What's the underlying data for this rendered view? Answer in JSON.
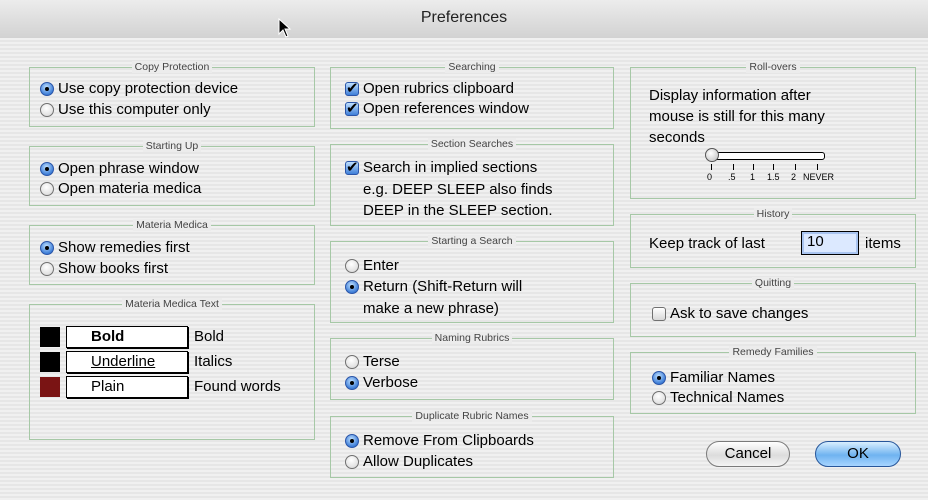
{
  "window": {
    "title": "Preferences"
  },
  "copy_protection": {
    "legend": "Copy Protection",
    "options": [
      {
        "label": "Use copy protection device",
        "selected": true
      },
      {
        "label": "Use this computer only",
        "selected": false
      }
    ]
  },
  "starting_up": {
    "legend": "Starting Up",
    "options": [
      {
        "label": "Open phrase window",
        "selected": true
      },
      {
        "label": "Open materia medica",
        "selected": false
      }
    ]
  },
  "materia_medica": {
    "legend": "Materia Medica",
    "options": [
      {
        "label": "Show remedies first",
        "selected": true
      },
      {
        "label": "Show books first",
        "selected": false
      }
    ]
  },
  "materia_medica_text": {
    "legend": "Materia Medica Text",
    "rows": [
      {
        "swatch_color": "#000000",
        "style_value": "Bold",
        "label": "Bold"
      },
      {
        "swatch_color": "#000000",
        "style_value": "Underline",
        "label": "Italics"
      },
      {
        "swatch_color": "#7a1414",
        "style_value": "Plain",
        "label": "Found words"
      }
    ]
  },
  "searching": {
    "legend": "Searching",
    "options": [
      {
        "label": "Open rubrics clipboard",
        "checked": true
      },
      {
        "label": "Open references window",
        "checked": true
      }
    ]
  },
  "section_searches": {
    "legend": "Section Searches",
    "checkbox_label": "Search in implied sections",
    "checked": true,
    "line2": "e.g. DEEP SLEEP also finds",
    "line3": "DEEP in the SLEEP section."
  },
  "starting_search": {
    "legend": "Starting a Search",
    "options": [
      {
        "label": "Enter",
        "selected": false
      },
      {
        "label": "Return (Shift-Return will",
        "selected": true
      }
    ],
    "continuation": "make a new phrase)"
  },
  "naming_rubrics": {
    "legend": "Naming Rubrics",
    "options": [
      {
        "label": "Terse",
        "selected": false
      },
      {
        "label": "Verbose",
        "selected": true
      }
    ]
  },
  "duplicate_rubric_names": {
    "legend": "Duplicate Rubric Names",
    "options": [
      {
        "label": "Remove From Clipboards",
        "selected": true
      },
      {
        "label": "Allow Duplicates",
        "selected": false
      }
    ]
  },
  "rollovers": {
    "legend": "Roll-overs",
    "line1": "Display information after",
    "line2": "mouse is still for this many",
    "line3": "seconds",
    "ticks": [
      "0",
      ".5",
      "1",
      "1.5",
      "2",
      "NEVER"
    ],
    "value": 0
  },
  "history": {
    "legend": "History",
    "prefix": "Keep track of last",
    "value": "10",
    "suffix": "items"
  },
  "quitting": {
    "legend": "Quitting",
    "checkbox_label": "Ask to save changes",
    "checked": false
  },
  "remedy_families": {
    "legend": "Remedy Families",
    "options": [
      {
        "label": "Familiar Names",
        "selected": true
      },
      {
        "label": "Technical Names",
        "selected": false
      }
    ]
  },
  "buttons": {
    "cancel": "Cancel",
    "ok": "OK"
  }
}
